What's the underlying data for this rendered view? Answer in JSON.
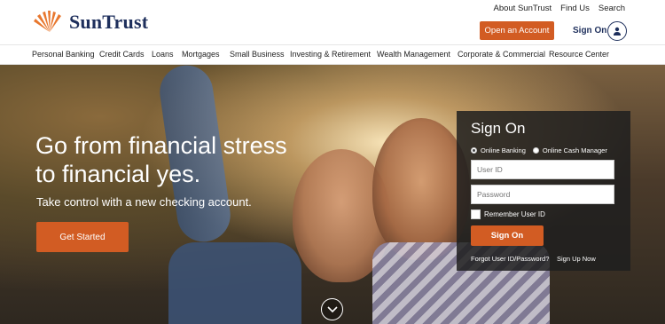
{
  "brand": {
    "name": "SunTrust"
  },
  "utility": [
    "About SunTrust",
    "Find Us",
    "Search"
  ],
  "header": {
    "open_account": "Open an Account",
    "sign_on": "Sign On"
  },
  "nav": [
    "Personal Banking",
    "Credit Cards",
    "Loans",
    "Mortgages",
    "Small Business",
    "Investing & Retirement",
    "Wealth Management",
    "Corporate & Commercial",
    "Resource Center"
  ],
  "hero": {
    "headline_line1": "Go from financial stress",
    "headline_line2": "to financial yes.",
    "subhead": "Take control with a new checking account.",
    "cta": "Get Started"
  },
  "signon": {
    "title": "Sign On",
    "options": [
      "Online Banking",
      "Online Cash Manager"
    ],
    "selected_option": "Online Banking",
    "userid_placeholder": "User ID",
    "password_placeholder": "Password",
    "remember": "Remember User ID",
    "button": "Sign On",
    "forgot": "Forgot User ID/Password?",
    "signup": "Sign Up Now"
  },
  "colors": {
    "accent": "#d25c23",
    "brand_navy": "#1e2f5c",
    "panel_bg": "#1e1e1e"
  },
  "icons": {
    "logo": "sunburst-logo-icon",
    "user": "user-icon",
    "scroll": "chevron-down-icon"
  }
}
